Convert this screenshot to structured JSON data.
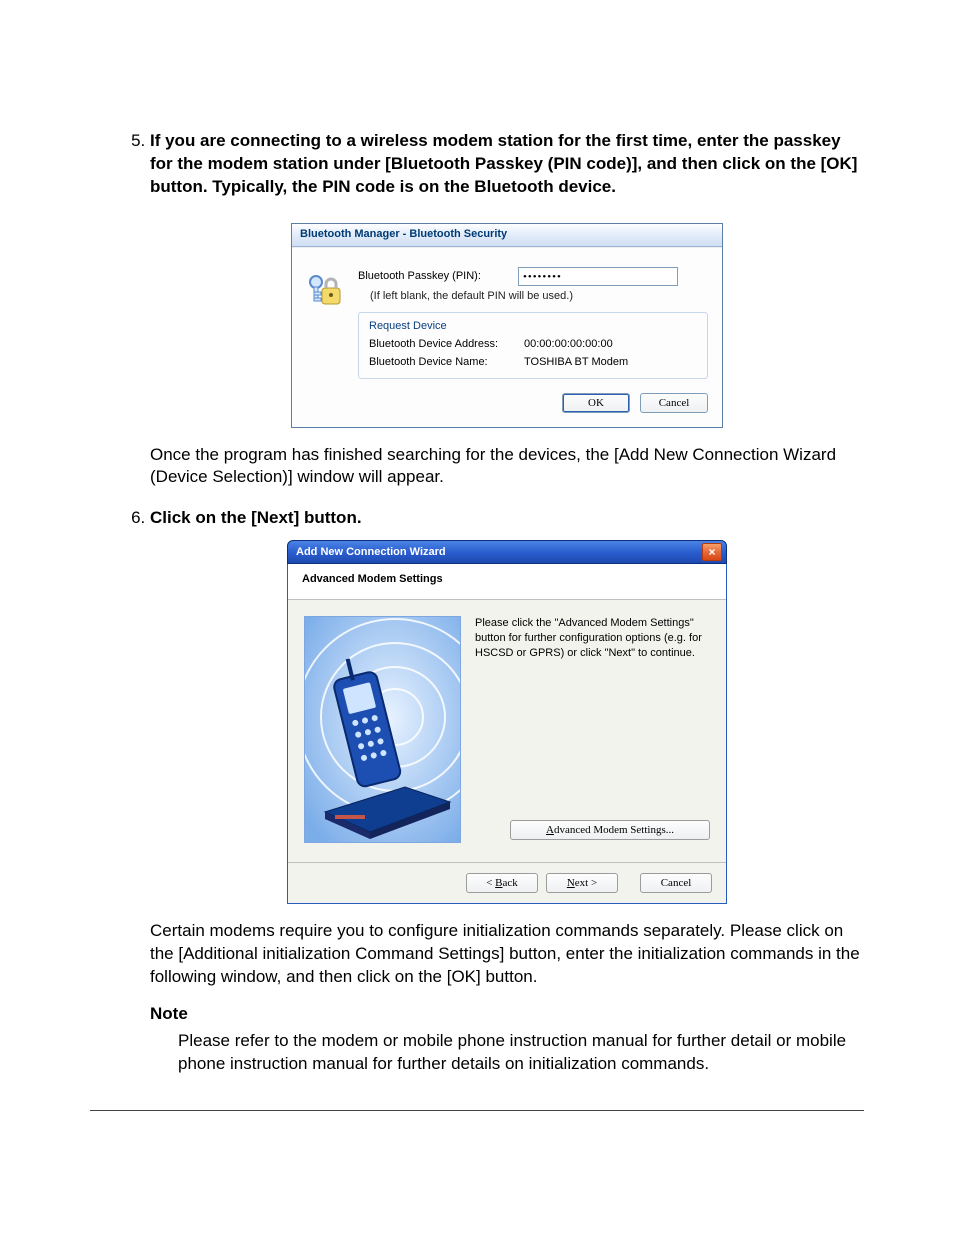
{
  "steps": {
    "five": {
      "number": "5.",
      "head": "If you are connecting to a wireless modem station for the first time, enter the passkey for the modem station under [Bluetooth Passkey (PIN code)], and then click on the [OK] button. Typically, the PIN code is on the Bluetooth device.",
      "after": "Once the program has finished searching for the devices, the [Add New Connection Wizard (Device Selection)] window will appear."
    },
    "six": {
      "number": "6.",
      "head": "Click on the [Next] button.",
      "after": "Certain modems require you to configure initialization commands separately. Please click on the [Additional initialization Command Settings] button, enter the initialization commands in the following window, and then click on the [OK] button.",
      "note_head": "Note",
      "note_body": "Please refer to the modem or mobile phone instruction manual for further detail or mobile phone instruction manual for further details on initialization commands."
    }
  },
  "dialog1": {
    "title": "Bluetooth Manager - Bluetooth Security",
    "passkey_label": "Bluetooth Passkey (PIN):",
    "passkey_value": "••••••••",
    "hint": "(If left blank, the default PIN will be used.)",
    "group_title": "Request Device",
    "addr_label": "Bluetooth Device Address:",
    "addr_value": "00:00:00:00:00:00",
    "name_label": "Bluetooth Device Name:",
    "name_value": "TOSHIBA BT Modem",
    "ok": "OK",
    "cancel": "Cancel"
  },
  "dialog2": {
    "title": "Add New Connection Wizard",
    "subtitle": "Advanced Modem Settings",
    "body": "Please click the \"Advanced Modem Settings\" button for further configuration options (e.g. for HSCSD or GPRS) or click \"Next\" to continue.",
    "adv_btn_pre": "A",
    "adv_btn_rest": "dvanced Modem Settings...",
    "back_pre": "< ",
    "back_u": "B",
    "back_rest": "ack",
    "next_u": "N",
    "next_rest": "ext >",
    "cancel": "Cancel"
  }
}
